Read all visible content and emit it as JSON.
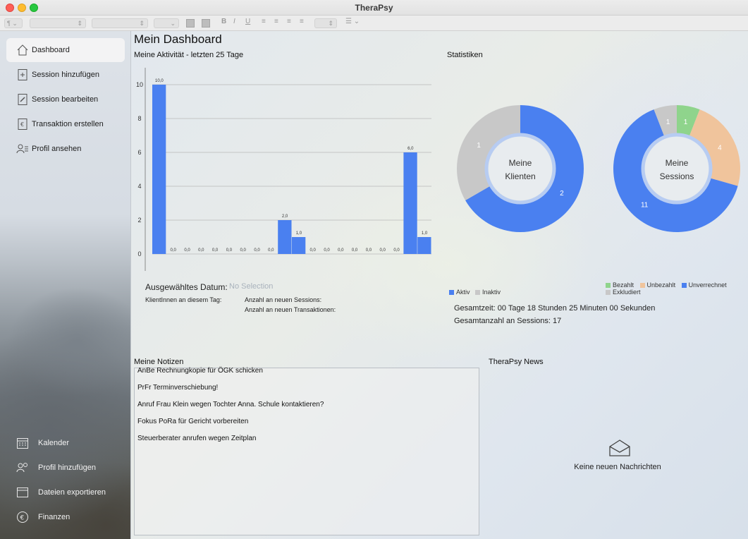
{
  "window": {
    "title": "TheraPsy"
  },
  "toolbar": {
    "para_label": "¶ ⌄",
    "bold": "B",
    "italic": "I",
    "underline": "U"
  },
  "sidebar": {
    "items": [
      {
        "label": "Dashboard",
        "icon": "house-icon",
        "active": true
      },
      {
        "label": "Session hinzufügen",
        "icon": "add-document-icon"
      },
      {
        "label": "Session bearbeiten",
        "icon": "edit-document-icon"
      },
      {
        "label": "Transaktion erstellen",
        "icon": "euro-document-icon"
      },
      {
        "label": "Profil ansehen",
        "icon": "profile-list-icon"
      }
    ],
    "bottom_items": [
      {
        "label": "Kalender",
        "icon": "calendar-icon"
      },
      {
        "label": "Profil hinzufügen",
        "icon": "add-profile-icon"
      },
      {
        "label": "Dateien exportieren",
        "icon": "export-icon"
      },
      {
        "label": "Finanzen",
        "icon": "euro-circle-icon"
      }
    ]
  },
  "main": {
    "title": "Mein Dashboard",
    "activity_title": "Meine Aktivität - letzten 25 Tage",
    "stats_title": "Statistiken",
    "selected_date_label": "Ausgewähltes Datum:",
    "selected_date_value": "No Selection",
    "clients_on_day": "KlientInnen an diesem Tag:",
    "new_sessions": "Anzahl an neuen Sessions:",
    "new_transactions": "Anzahl an neuen Transaktionen:",
    "total_time": "Gesamtzeit:  00 Tage 18 Stunden 25 Minuten 00 Sekunden",
    "total_sessions": "Gesamtanzahl an Sessions:  17",
    "notes_title": "Meine Notizen",
    "notes": [
      "AnBe Rechnungkopie für ÖGK schicken",
      "PrFr Terminverschiebung!",
      "Anruf Frau Klein wegen Tochter Anna. Schule kontaktieren?",
      "Fokus PoRa für Gericht vorbereiten",
      "Steuerberater anrufen wegen Zeitplan"
    ],
    "news_title": "TheraPsy News",
    "news_empty": "Keine neuen Nachrichten",
    "donut1": {
      "center_line1": "Meine",
      "center_line2": "Klienten"
    },
    "donut2": {
      "center_line1": "Meine",
      "center_line2": "Sessions"
    },
    "legend1": [
      "Aktiv",
      "Inaktiv"
    ],
    "legend2": [
      "Bezahlt",
      "Unbezahlt",
      "Unverrechnet",
      "Exkludiert"
    ]
  },
  "colors": {
    "blue": "#4a80f0",
    "gray": "#c8c8c8",
    "green": "#8fd48c",
    "peach": "#f0c49c"
  },
  "chart_data": [
    {
      "type": "bar",
      "title": "Meine Aktivität - letzten 25 Tage",
      "y_ticks": [
        "0",
        "2",
        "4",
        "6",
        "8",
        "10"
      ],
      "ylim": [
        0,
        10.5
      ],
      "values": [
        10,
        0,
        0,
        0,
        0,
        0,
        0,
        0,
        0,
        2,
        1,
        0,
        0,
        0,
        0,
        0,
        0,
        0,
        6,
        1
      ],
      "value_labels": [
        "10,0",
        "0,0",
        "0,0",
        "0,0",
        "0,0",
        "0,0",
        "0,0",
        "0,0",
        "0,0",
        "2,0",
        "1,0",
        "0,0",
        "0,0",
        "0,0",
        "0,0",
        "0,0",
        "0,0",
        "0,0",
        "6,0",
        "1,0"
      ]
    },
    {
      "type": "pie",
      "title": "Meine Klienten",
      "slices": [
        {
          "name": "Aktiv",
          "value": 2,
          "color": "#4a80f0"
        },
        {
          "name": "Inaktiv",
          "value": 1,
          "color": "#c8c8c8"
        }
      ]
    },
    {
      "type": "pie",
      "title": "Meine Sessions",
      "slices": [
        {
          "name": "Bezahlt",
          "value": 1,
          "color": "#8fd48c"
        },
        {
          "name": "Unbezahlt",
          "value": 4,
          "color": "#f0c49c"
        },
        {
          "name": "Unverrechnet",
          "value": 11,
          "color": "#4a80f0"
        },
        {
          "name": "Exkludiert",
          "value": 1,
          "color": "#c8c8c8"
        }
      ]
    }
  ]
}
